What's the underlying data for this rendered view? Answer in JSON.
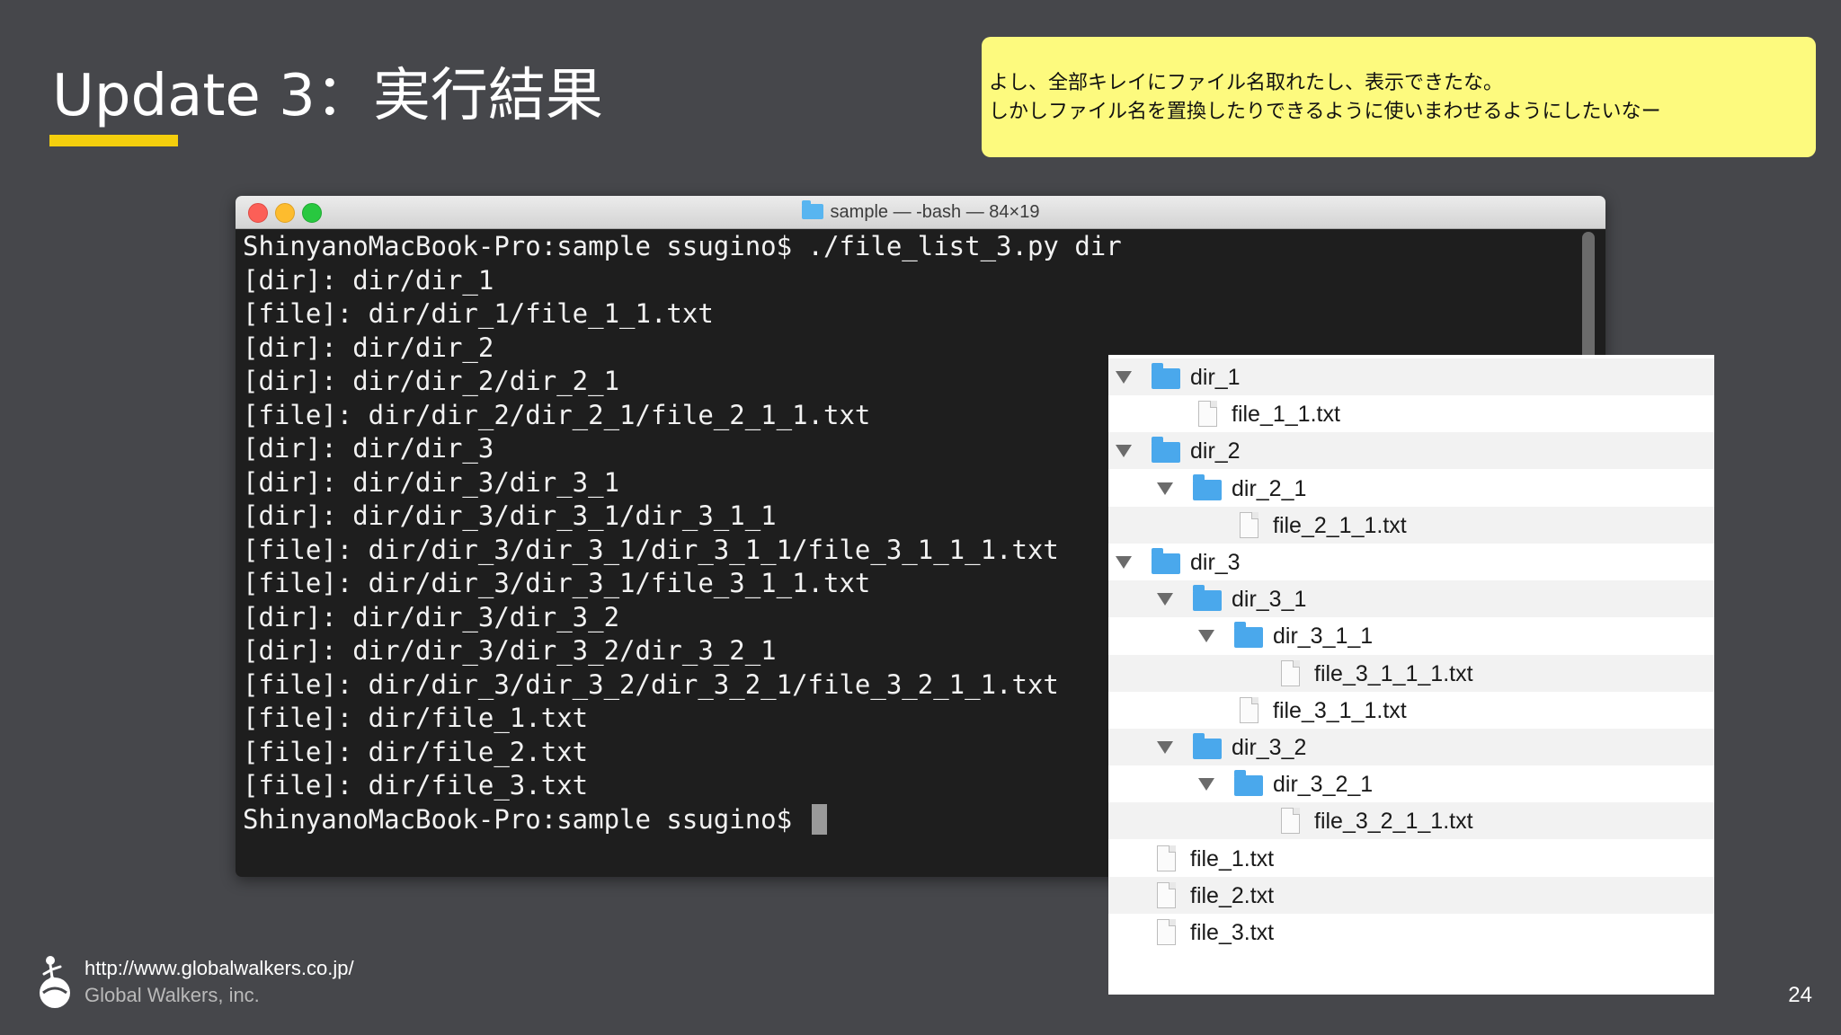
{
  "slide": {
    "title": "Update 3：実行結果",
    "page_number": "24"
  },
  "note": {
    "line1": "よし、全部キレイにファイル名取れたし、表示できたな。",
    "line2": "しかしファイル名を置換したりできるように使いまわせるようにしたいなー"
  },
  "terminal": {
    "window_title": "sample — -bash — 84×19",
    "lines": [
      "ShinyanoMacBook-Pro:sample ssugino$ ./file_list_3.py dir",
      "[dir]: dir/dir_1",
      "[file]: dir/dir_1/file_1_1.txt",
      "[dir]: dir/dir_2",
      "[dir]: dir/dir_2/dir_2_1",
      "[file]: dir/dir_2/dir_2_1/file_2_1_1.txt",
      "[dir]: dir/dir_3",
      "[dir]: dir/dir_3/dir_3_1",
      "[dir]: dir/dir_3/dir_3_1/dir_3_1_1",
      "[file]: dir/dir_3/dir_3_1/dir_3_1_1/file_3_1_1_1.txt",
      "[file]: dir/dir_3/dir_3_1/file_3_1_1.txt",
      "[dir]: dir/dir_3/dir_3_2",
      "[dir]: dir/dir_3/dir_3_2/dir_3_2_1",
      "[file]: dir/dir_3/dir_3_2/dir_3_2_1/file_3_2_1_1.txt",
      "[file]: dir/file_1.txt",
      "[file]: dir/file_2.txt",
      "[file]: dir/file_3.txt",
      "ShinyanoMacBook-Pro:sample ssugino$ "
    ]
  },
  "finder": {
    "items": [
      {
        "label": "dir_1",
        "type": "folder",
        "depth": 0,
        "expanded": true
      },
      {
        "label": "file_1_1.txt",
        "type": "file",
        "depth": 1
      },
      {
        "label": "dir_2",
        "type": "folder",
        "depth": 0,
        "expanded": true
      },
      {
        "label": "dir_2_1",
        "type": "folder",
        "depth": 1,
        "expanded": true
      },
      {
        "label": "file_2_1_1.txt",
        "type": "file",
        "depth": 2
      },
      {
        "label": "dir_3",
        "type": "folder",
        "depth": 0,
        "expanded": true
      },
      {
        "label": "dir_3_1",
        "type": "folder",
        "depth": 1,
        "expanded": true
      },
      {
        "label": "dir_3_1_1",
        "type": "folder",
        "depth": 2,
        "expanded": true
      },
      {
        "label": "file_3_1_1_1.txt",
        "type": "file",
        "depth": 3
      },
      {
        "label": "file_3_1_1.txt",
        "type": "file",
        "depth": 2
      },
      {
        "label": "dir_3_2",
        "type": "folder",
        "depth": 1,
        "expanded": true
      },
      {
        "label": "dir_3_2_1",
        "type": "folder",
        "depth": 2,
        "expanded": true
      },
      {
        "label": "file_3_2_1_1.txt",
        "type": "file",
        "depth": 3
      },
      {
        "label": "file_1.txt",
        "type": "file",
        "depth": 0
      },
      {
        "label": "file_2.txt",
        "type": "file",
        "depth": 0
      },
      {
        "label": "file_3.txt",
        "type": "file",
        "depth": 0
      }
    ]
  },
  "footer": {
    "url": "http://www.globalwalkers.co.jp/",
    "company": "Global Walkers, inc."
  },
  "colors": {
    "background": "#46474b",
    "accent_underline": "#f4cf0d",
    "note_background": "#fdfa7e",
    "terminal_background": "#1e1e1e",
    "folder_blue": "#4aa8ec"
  }
}
